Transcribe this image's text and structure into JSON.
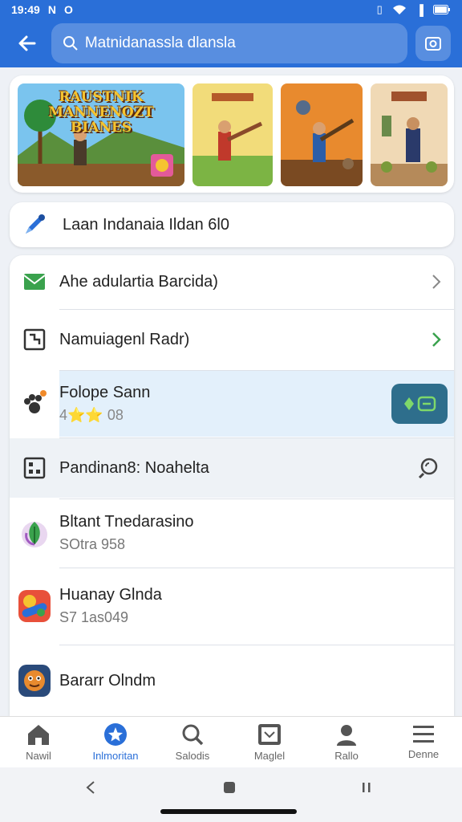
{
  "status_bar": {
    "time": "19:49",
    "battery": "100"
  },
  "search": {
    "query": "Matnidanassla dlansla"
  },
  "banner": {
    "title": "RAUSTNIK MANNENOZT BIANES"
  },
  "promo": {
    "label": "Laan Indanaia Ildan 6l0"
  },
  "list": [
    {
      "title": "Ahe adulartia Barcida)",
      "subtitle": ""
    },
    {
      "title": "Namuiagenl Radr)",
      "subtitle": ""
    },
    {
      "title": "Folope Sann",
      "subtitle": "4⭐⭐ 08"
    },
    {
      "title": "Pandinan8: Noahelta",
      "subtitle": ""
    },
    {
      "title": "Bltant Tnedarasino",
      "subtitle": "SOtra 958"
    },
    {
      "title": "Huanay Glnda",
      "subtitle": "S7 1as049"
    },
    {
      "title": "Bararr Olndm",
      "subtitle": ""
    }
  ],
  "bottom_nav": [
    {
      "label": "Nawil",
      "icon": "home-icon"
    },
    {
      "label": "Inlmoritan",
      "icon": "star-badge-icon",
      "active": true
    },
    {
      "label": "Salodis",
      "icon": "search-icon"
    },
    {
      "label": "Maglel",
      "icon": "screen-icon"
    },
    {
      "label": "Rallo",
      "icon": "person-icon"
    },
    {
      "label": "Denne",
      "icon": "menu-icon"
    }
  ],
  "colors": {
    "primary": "#2a6fd8",
    "highlight": "#e3f0fb",
    "accent_green": "#3aa24d",
    "action_btn": "#2e6e8c"
  }
}
